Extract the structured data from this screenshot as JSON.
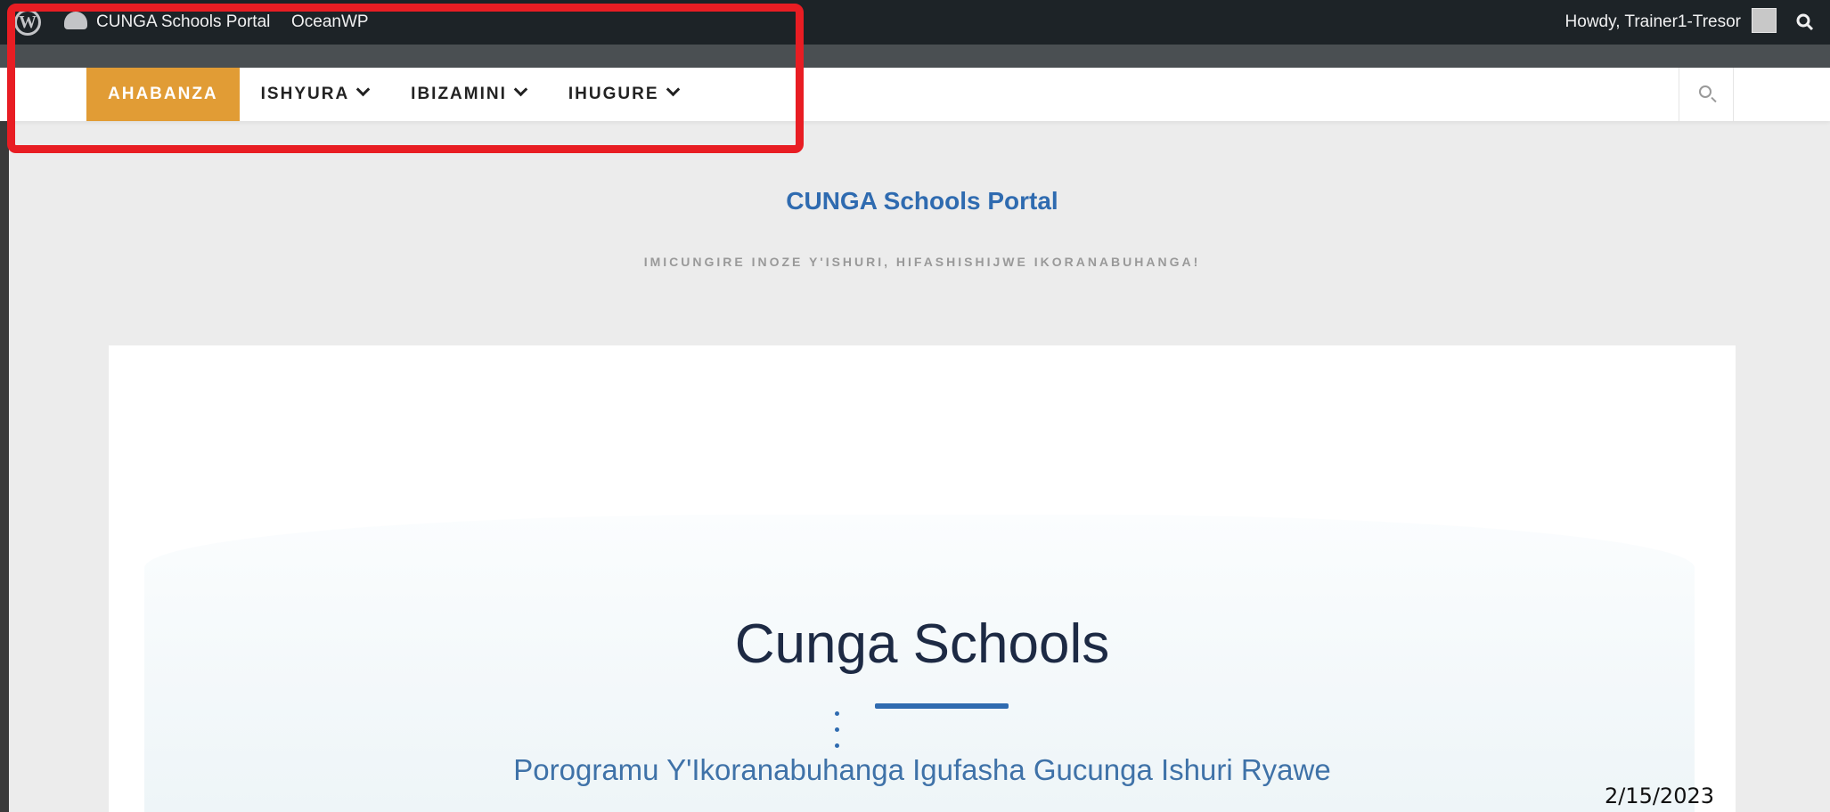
{
  "admin_bar": {
    "site_name": "CUNGA Schools Portal",
    "theme_name": "OceanWP",
    "greeting": "Howdy, Trainer1-Tresor"
  },
  "nav": {
    "items": [
      {
        "label": "AHABANZA",
        "active": true,
        "has_dropdown": false
      },
      {
        "label": "ISHYURA",
        "active": false,
        "has_dropdown": true
      },
      {
        "label": "IBIZAMINI",
        "active": false,
        "has_dropdown": true
      },
      {
        "label": "IHUGURE",
        "active": false,
        "has_dropdown": true
      }
    ],
    "search_icon": "search-icon"
  },
  "branding": {
    "title": "CUNGA Schools Portal",
    "description": "IMICUNGIRE INOZE Y'ISHURI, HIFASHISHIJWE IKORANABUHANGA!"
  },
  "hero": {
    "title": "Cunga Schools",
    "subtitle": "Porogramu Y'Ikoranabuhanga Igufasha Gucunga Ishuri Ryawe"
  },
  "date_stamp": "2/15/2023",
  "colors": {
    "admin_bar": "#1d2327",
    "nav_active": "#e19c35",
    "highlight": "#e81d23",
    "link_blue": "#2f6bb0"
  }
}
